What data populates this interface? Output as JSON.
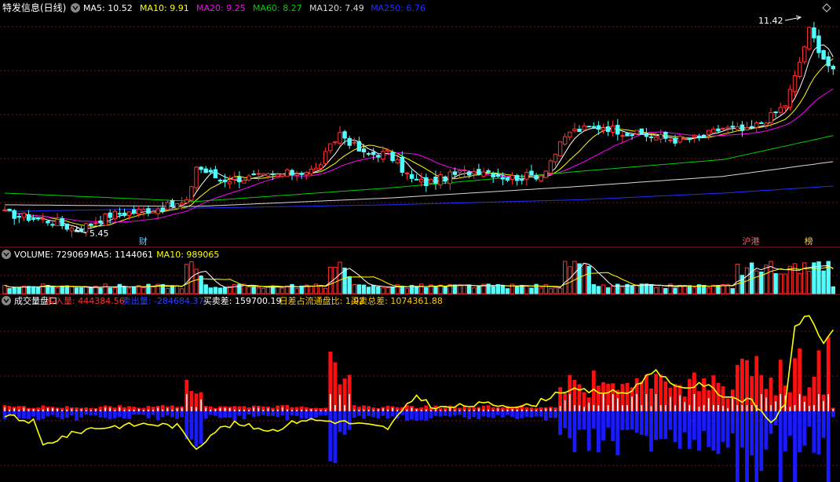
{
  "colors": {
    "background": "#000000",
    "up": "#ff3232",
    "down": "#54ffff",
    "grid": "#7a1212",
    "frame": "#a01010",
    "ma5": "#ffffff",
    "ma10": "#ffff00",
    "ma20": "#ff00ff",
    "ma60": "#00d000",
    "ma120": "#d8d8d8",
    "ma250": "#2030ff",
    "buy_bar": "#ff1010",
    "sell_bar": "#1a1aff",
    "diff_line": "#ffff00"
  },
  "panels": {
    "price": {
      "title": "特发信息(日线)",
      "ma_labels": [
        {
          "text": "MA5: 10.52",
          "color": "#ffffff"
        },
        {
          "text": "MA10: 9.91",
          "color": "#ffff00"
        },
        {
          "text": "MA20: 9.25",
          "color": "#ff00ff"
        },
        {
          "text": "MA60: 8.27",
          "color": "#00d000"
        },
        {
          "text": "MA120: 7.49",
          "color": "#d8d8d8"
        },
        {
          "text": "MA250: 6.76",
          "color": "#2030ff"
        }
      ],
      "high_label": "11.42",
      "low_label": "5.45",
      "event_markers": [
        {
          "text": "财",
          "color": "#66ccff",
          "bar_index": 29
        },
        {
          "text": "沪港",
          "color": "#ff6666",
          "bar_index": 155
        },
        {
          "text": "榜",
          "color": "#ffcc33",
          "bar_index": 168
        }
      ]
    },
    "volume": {
      "labels": [
        {
          "text": "VOLUME: 729069",
          "color": "#ffffff"
        },
        {
          "text": "MA5: 1144061",
          "color": "#ffffff"
        },
        {
          "text": "MA10: 989065",
          "color": "#ffff00"
        }
      ]
    },
    "indicator": {
      "labels": [
        {
          "text": "成交量盘口",
          "color": "#ffffff"
        },
        {
          "text": "买入量: 444384.56",
          "color": "#ff3030"
        },
        {
          "text": "卖出量: -284684.37",
          "color": "#3040ff"
        },
        {
          "text": "买卖差: 159700.19",
          "color": "#ffffff"
        },
        {
          "text": "日差占流通盘比: 1.92",
          "color": "#ffcc00"
        },
        {
          "text": "买卖总差: 1074361.88",
          "color": "#ffcc00"
        }
      ]
    }
  },
  "chart_data": {
    "type": "candlestick",
    "price_range": [
      5.0,
      11.9
    ],
    "dates": [],
    "ohlc": [],
    "moving_averages": {
      "ma5_last": 10.52,
      "ma10_last": 9.91,
      "ma20_last": 9.25,
      "ma60_last": 8.27,
      "ma120_last": 7.49,
      "ma250_last": 6.76
    },
    "high": 11.42,
    "low": 5.45,
    "volume_last": 729069,
    "volume_ma5": 1144061,
    "volume_ma10": 989065,
    "buy_volume": 444384.56,
    "sell_volume": -284684.37,
    "buy_sell_diff": 159700.19,
    "diff_float_ratio": 1.92,
    "total_diff": 1074361.88,
    "trend_anchors": [
      [
        0,
        5.95
      ],
      [
        10,
        5.7
      ],
      [
        15,
        5.45
      ],
      [
        22,
        5.9
      ],
      [
        30,
        6.05
      ],
      [
        38,
        6.25
      ],
      [
        40,
        7.35
      ],
      [
        45,
        6.95
      ],
      [
        55,
        7.05
      ],
      [
        65,
        7.25
      ],
      [
        70,
        8.35
      ],
      [
        75,
        7.7
      ],
      [
        80,
        7.75
      ],
      [
        85,
        6.95
      ],
      [
        88,
        6.85
      ],
      [
        95,
        7.15
      ],
      [
        100,
        7.25
      ],
      [
        105,
        7.0
      ],
      [
        112,
        7.1
      ],
      [
        118,
        8.4
      ],
      [
        125,
        8.55
      ],
      [
        130,
        8.35
      ],
      [
        140,
        8.15
      ],
      [
        145,
        8.2
      ],
      [
        150,
        8.5
      ],
      [
        155,
        8.4
      ],
      [
        160,
        8.85
      ],
      [
        163,
        9.2
      ],
      [
        165,
        10.0
      ],
      [
        168,
        11.42
      ],
      [
        171,
        10.6
      ],
      [
        173,
        10.15
      ]
    ],
    "diff_line_anchors": [
      [
        0,
        -0.2
      ],
      [
        3,
        -0.4
      ],
      [
        6,
        -0.5
      ],
      [
        8,
        -1.6
      ],
      [
        12,
        -1.2
      ],
      [
        18,
        -0.8
      ],
      [
        24,
        -0.7
      ],
      [
        30,
        -0.6
      ],
      [
        36,
        -0.7
      ],
      [
        40,
        -1.7
      ],
      [
        44,
        -0.9
      ],
      [
        48,
        -0.6
      ],
      [
        56,
        -0.9
      ],
      [
        62,
        -0.4
      ],
      [
        70,
        -0.5
      ],
      [
        80,
        -0.8
      ],
      [
        86,
        0.7
      ],
      [
        90,
        0.1
      ],
      [
        100,
        0.3
      ],
      [
        110,
        0.2
      ],
      [
        116,
        0.9
      ],
      [
        120,
        0.9
      ],
      [
        130,
        0.8
      ],
      [
        136,
        1.9
      ],
      [
        140,
        1.0
      ],
      [
        146,
        1.2
      ],
      [
        150,
        0.7
      ],
      [
        156,
        0.4
      ],
      [
        160,
        -0.5
      ],
      [
        163,
        0.2
      ],
      [
        165,
        3.9
      ],
      [
        168,
        4.3
      ],
      [
        171,
        3.1
      ],
      [
        173,
        3.6
      ]
    ]
  }
}
